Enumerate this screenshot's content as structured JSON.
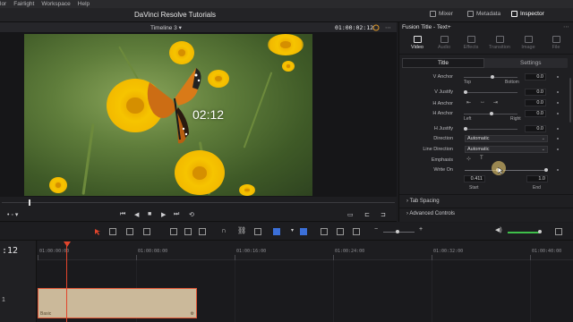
{
  "menu": [
    "lor",
    "Fairlight",
    "Workspace",
    "Help"
  ],
  "header": {
    "title": "DaVinci Resolve Tutorials",
    "mixer": "Mixer",
    "metadata": "Metadata",
    "inspector": "Inspector"
  },
  "viewer": {
    "timeline_name": "Timeline 3",
    "timecode": "01:00:02:12",
    "overlay_text": "02:12"
  },
  "inspector": {
    "title": "Fusion Title - Text+",
    "tabs": [
      "Video",
      "Audio",
      "Effects",
      "Transition",
      "Image",
      "File"
    ],
    "subtabs": [
      "Title",
      "Settings"
    ],
    "v_anchor": {
      "label": "V Anchor",
      "value": "0.0",
      "left": "Top",
      "right": "Bottom"
    },
    "v_justify": {
      "label": "V Justify",
      "value": "0.0"
    },
    "h_anchor": {
      "label": "H Anchor",
      "value": "0.0"
    },
    "h_anchor_slider": {
      "label": "H Anchor",
      "value": "0.0",
      "left": "Left",
      "right": "Right"
    },
    "h_justify": {
      "label": "H Justify",
      "value": "0.0"
    },
    "direction": {
      "label": "Direction",
      "value": "Automatic"
    },
    "line_direction": {
      "label": "Line Direction",
      "value": "Automatic"
    },
    "emphasis": {
      "label": "Emphasis"
    },
    "write_on": {
      "label": "Write On",
      "start": "0.411",
      "end": "1.0",
      "start_label": "Start",
      "end_label": "End"
    },
    "sections": [
      "Tab Spacing",
      "Advanced Controls"
    ]
  },
  "timeline": {
    "timecode": ":12",
    "ruler": [
      "01:00:00:00",
      "01:00:08:00",
      "01:00:16:00",
      "01:00:24:00",
      "01:00:32:00",
      "01:00:40:00"
    ],
    "track_number": "1",
    "clip_name": "Basic"
  },
  "colors": {
    "accent": "#e2452c",
    "clip": "#cbb99a",
    "panel": "#1f1f22"
  }
}
